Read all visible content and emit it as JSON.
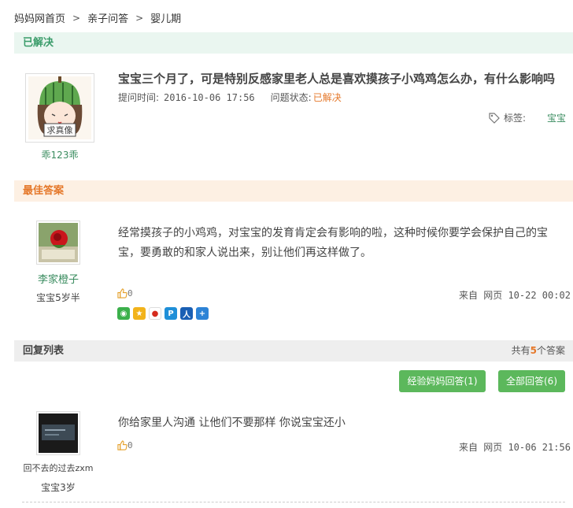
{
  "breadcrumb": [
    "妈妈网首页",
    "亲子问答",
    "婴儿期"
  ],
  "question": {
    "section_label": "已解决",
    "title": "宝宝三个月了，可是特别反感家里老人总是喜欢摸孩子小鸡鸡怎么办，有什么影响吗",
    "time_label": "提问时间:",
    "time": "2016-10-06 17:56",
    "status_label": "问题状态:",
    "status": "已解决",
    "tag_label": "标签:",
    "tag": "宝宝",
    "asker": {
      "name": "乖123乖",
      "avatar_text": "求真像"
    }
  },
  "best_answer": {
    "section_label": "最佳答案",
    "user": {
      "name": "李家橙子",
      "role": "宝宝5岁半"
    },
    "text": "经常摸孩子的小鸡鸡，对宝宝的发育肯定会有影响的啦，这种时候你要学会保护自己的宝宝，要勇敢的和家人说出来，别让他们再这样做了。",
    "likes": "0",
    "source": "来自 网页 10-22 00:02",
    "share_icons": [
      "wechat-icon",
      "qzone-icon",
      "weibo-icon",
      "pengyou-icon",
      "renren-icon",
      "more-share-icon"
    ]
  },
  "reply_list": {
    "section_label": "回复列表",
    "count_prefix": "共有",
    "count": "5",
    "count_suffix": "个答案",
    "buttons": {
      "experienced": "经验妈妈回答(1)",
      "all": "全部回答(6)"
    },
    "replies": [
      {
        "user": "回不去的过去zxm",
        "role": "宝宝3岁",
        "text": "你给家里人沟通 让他们不要那样 你说宝宝还小",
        "likes": "0",
        "source": "来自 网页 10-06 21:56"
      }
    ]
  },
  "colors": {
    "green": "#3a8c5f",
    "orange": "#e5782a",
    "button": "#5cb85c"
  }
}
